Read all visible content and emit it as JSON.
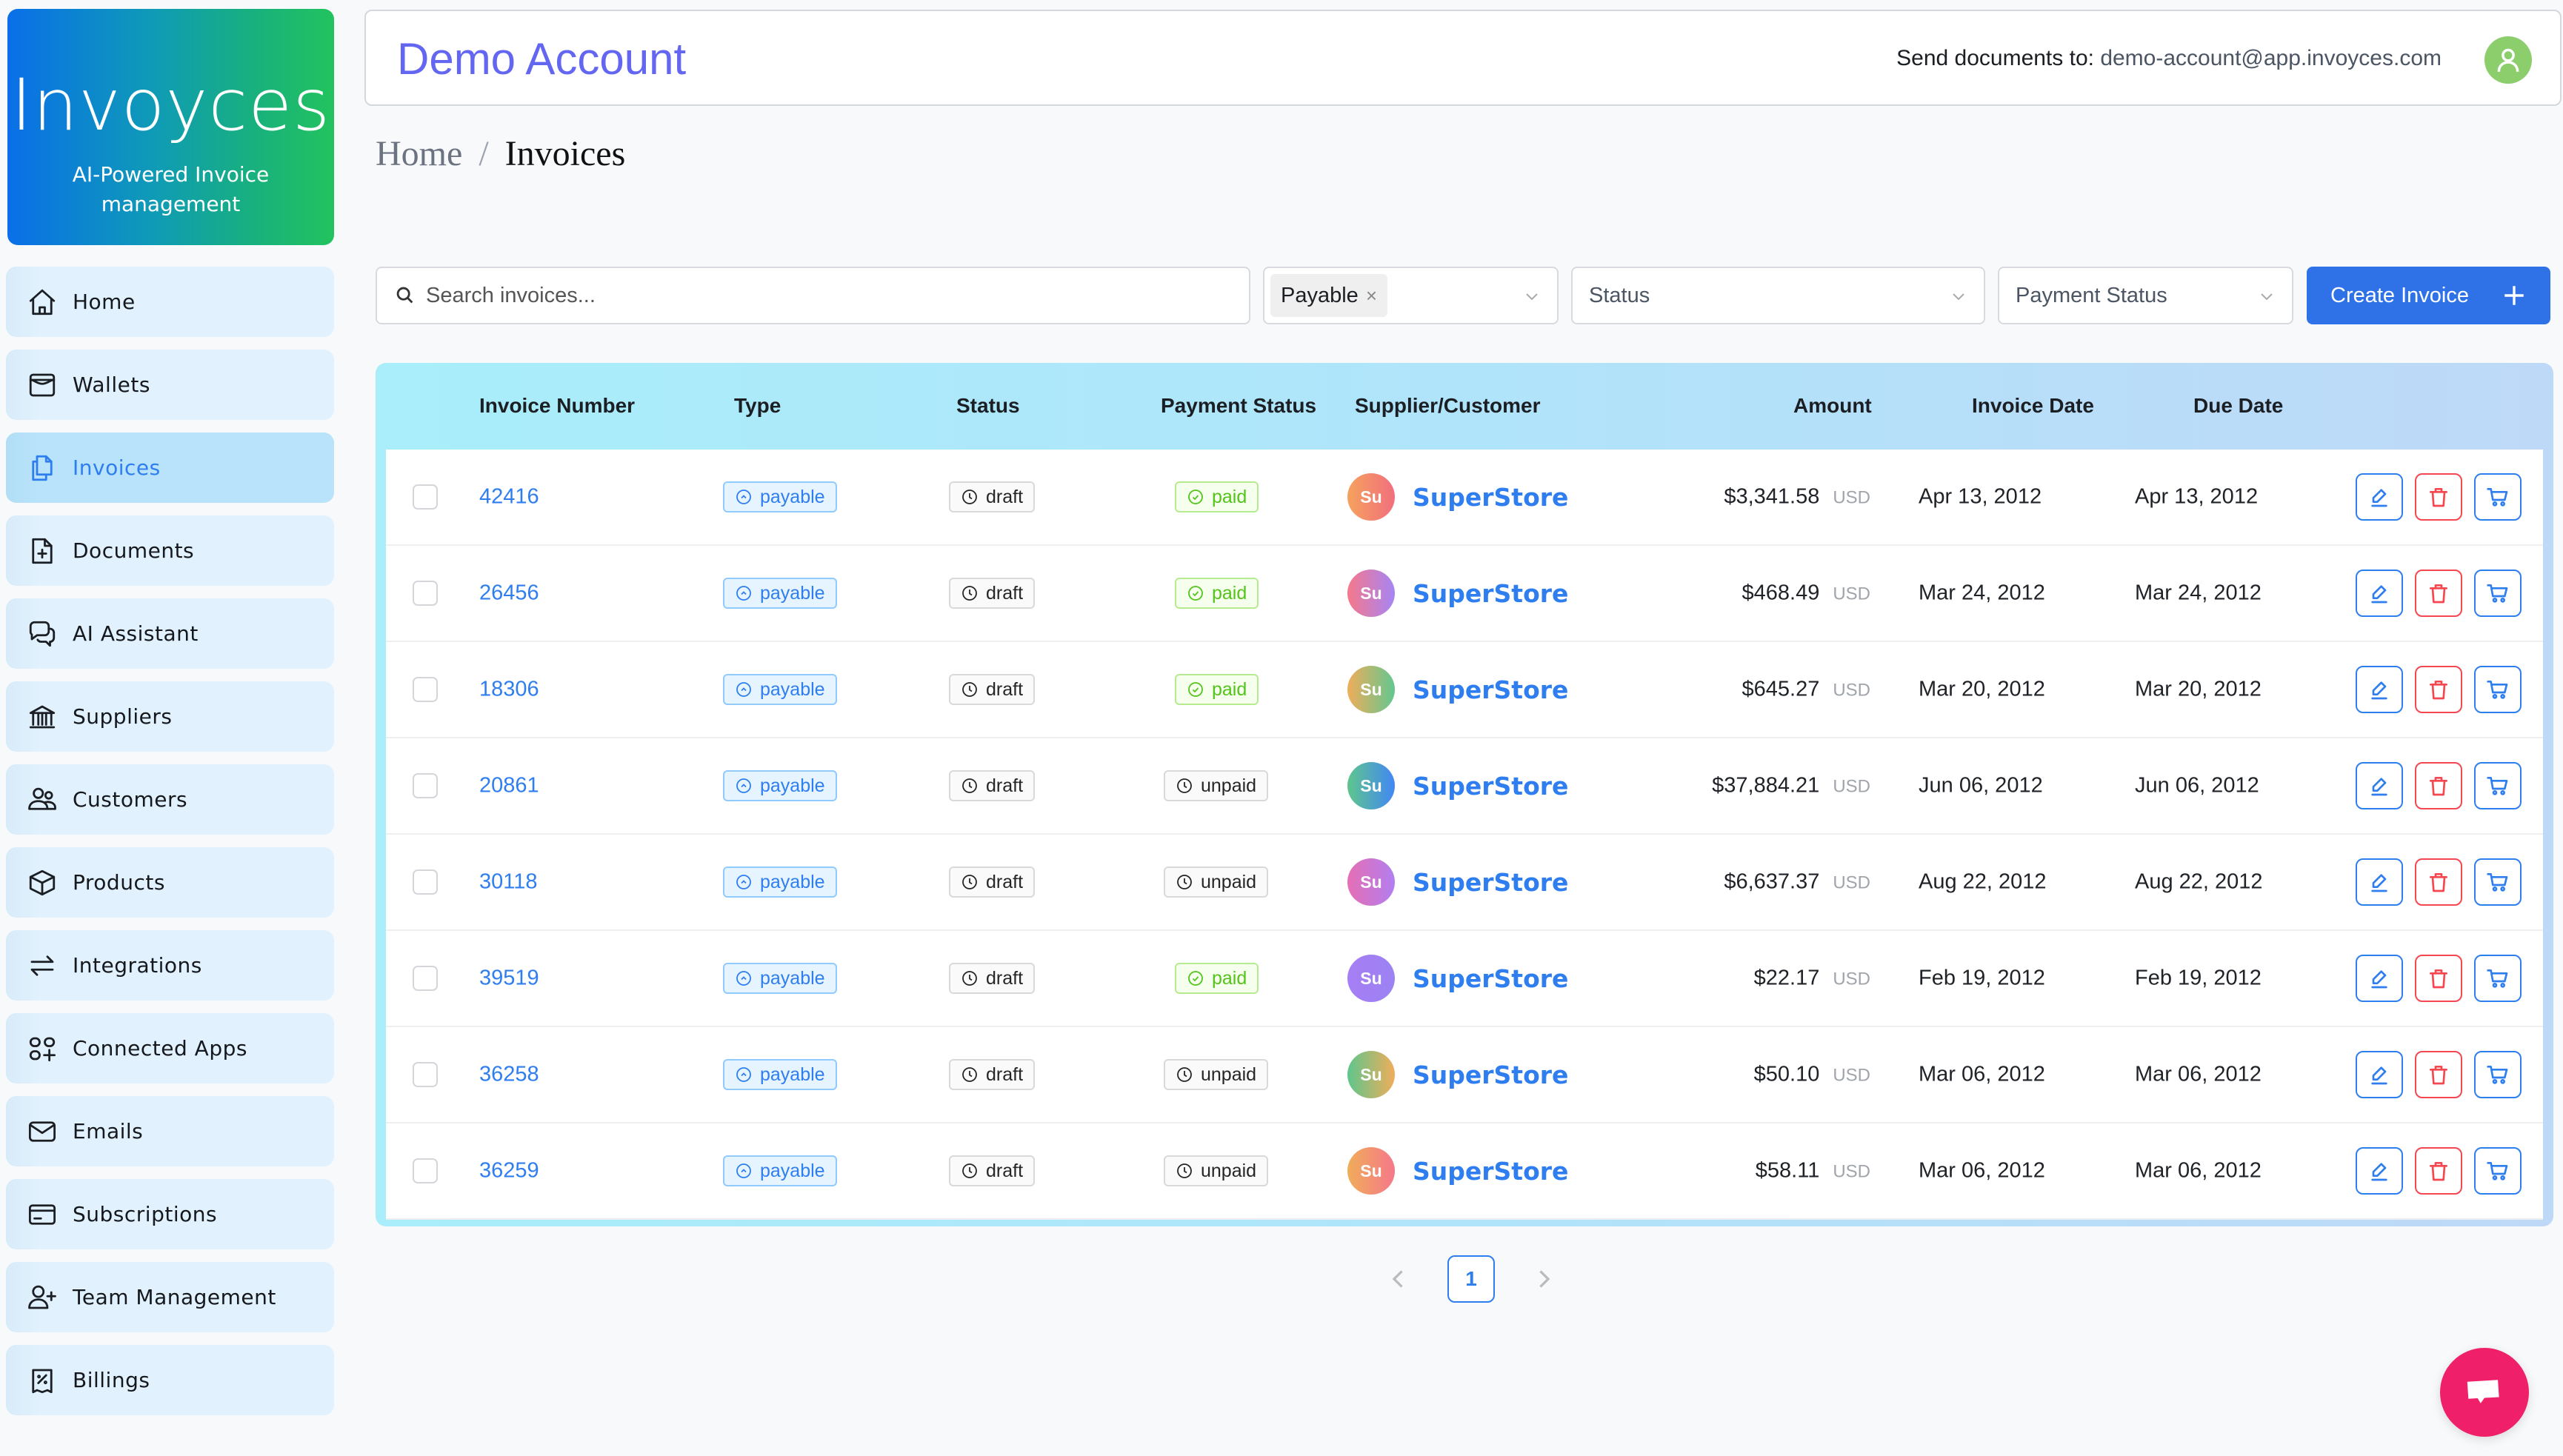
{
  "logo": {
    "title": "Invoyces",
    "subtitle": "AI-Powered Invoice management"
  },
  "sidebar": {
    "items": [
      {
        "label": "Home",
        "icon": "home-icon",
        "active": false
      },
      {
        "label": "Wallets",
        "icon": "wallet-icon",
        "active": false
      },
      {
        "label": "Invoices",
        "icon": "copy-documents-icon",
        "active": true
      },
      {
        "label": "Documents",
        "icon": "file-plus-icon",
        "active": false
      },
      {
        "label": "AI Assistant",
        "icon": "chat-bubbles-icon",
        "active": false
      },
      {
        "label": "Suppliers",
        "icon": "bank-icon",
        "active": false
      },
      {
        "label": "Customers",
        "icon": "users-icon",
        "active": false
      },
      {
        "label": "Products",
        "icon": "box-icon",
        "active": false
      },
      {
        "label": "Integrations",
        "icon": "arrows-exchange-icon",
        "active": false
      },
      {
        "label": "Connected Apps",
        "icon": "apps-add-icon",
        "active": false
      },
      {
        "label": "Emails",
        "icon": "mail-icon",
        "active": false
      },
      {
        "label": "Subscriptions",
        "icon": "credit-card-icon",
        "active": false
      },
      {
        "label": "Team Management",
        "icon": "user-add-icon",
        "active": false
      },
      {
        "label": "Billings",
        "icon": "receipt-percent-icon",
        "active": false
      }
    ]
  },
  "header": {
    "title": "Demo Account",
    "send_label": "Send documents to:",
    "send_email": "demo-account@app.invoyces.com",
    "avatar_color": "#8cce6c"
  },
  "breadcrumb": {
    "home": "Home",
    "separator": "/",
    "current": "Invoices"
  },
  "filters": {
    "search_placeholder": "Search invoices...",
    "search_value": "",
    "type_tag": "Payable",
    "type_tag_remove": "×",
    "status_placeholder": "Status",
    "payment_status_placeholder": "Payment Status",
    "create_button": "Create Invoice"
  },
  "table": {
    "columns": [
      "Invoice Number",
      "Type",
      "Status",
      "Payment Status",
      "Supplier/Customer",
      "Amount",
      "Invoice Date",
      "Due Date"
    ],
    "rows": [
      {
        "number": "42416",
        "type": "payable",
        "status": "draft",
        "payment": "paid",
        "avatar": "Su",
        "supplier": "SuperStore",
        "amount": "$3,341.58",
        "currency": "USD",
        "invoice_date": "Apr 13, 2012",
        "due_date": "Apr 13, 2012",
        "avatar_gradient": [
          "#f5a25d",
          "#f26f7e"
        ]
      },
      {
        "number": "26456",
        "type": "payable",
        "status": "draft",
        "payment": "paid",
        "avatar": "Su",
        "supplier": "SuperStore",
        "amount": "$468.49",
        "currency": "USD",
        "invoice_date": "Mar 24, 2012",
        "due_date": "Mar 24, 2012",
        "avatar_gradient": [
          "#f5788a",
          "#a685f5"
        ]
      },
      {
        "number": "18306",
        "type": "payable",
        "status": "draft",
        "payment": "paid",
        "avatar": "Su",
        "supplier": "SuperStore",
        "amount": "$645.27",
        "currency": "USD",
        "invoice_date": "Mar 20, 2012",
        "due_date": "Mar 20, 2012",
        "avatar_gradient": [
          "#f0ad5a",
          "#62c790"
        ]
      },
      {
        "number": "20861",
        "type": "payable",
        "status": "draft",
        "payment": "unpaid",
        "avatar": "Su",
        "supplier": "SuperStore",
        "amount": "$37,884.21",
        "currency": "USD",
        "invoice_date": "Jun 06, 2012",
        "due_date": "Jun 06, 2012",
        "avatar_gradient": [
          "#5ec68c",
          "#4287f5"
        ]
      },
      {
        "number": "30118",
        "type": "payable",
        "status": "draft",
        "payment": "unpaid",
        "avatar": "Su",
        "supplier": "SuperStore",
        "amount": "$6,637.37",
        "currency": "USD",
        "invoice_date": "Aug 22, 2012",
        "due_date": "Aug 22, 2012",
        "avatar_gradient": [
          "#e66fb4",
          "#b27ef0"
        ]
      },
      {
        "number": "39519",
        "type": "payable",
        "status": "draft",
        "payment": "paid",
        "avatar": "Su",
        "supplier": "SuperStore",
        "amount": "$22.17",
        "currency": "USD",
        "invoice_date": "Feb 19, 2012",
        "due_date": "Feb 19, 2012",
        "avatar_gradient": [
          "#a77ef5",
          "#9b82f2"
        ]
      },
      {
        "number": "36258",
        "type": "payable",
        "status": "draft",
        "payment": "unpaid",
        "avatar": "Su",
        "supplier": "SuperStore",
        "amount": "$50.10",
        "currency": "USD",
        "invoice_date": "Mar 06, 2012",
        "due_date": "Mar 06, 2012",
        "avatar_gradient": [
          "#5ec68c",
          "#f0ad5a"
        ]
      },
      {
        "number": "36259",
        "type": "payable",
        "status": "draft",
        "payment": "unpaid",
        "avatar": "Su",
        "supplier": "SuperStore",
        "amount": "$58.11",
        "currency": "USD",
        "invoice_date": "Mar 06, 2012",
        "due_date": "Mar 06, 2012",
        "avatar_gradient": [
          "#f0ad5a",
          "#f5788a"
        ]
      }
    ]
  },
  "pagination": {
    "current_page": "1"
  },
  "colors": {
    "accent": "#2f7ef0",
    "title": "#6366f1",
    "danger": "#f5474f",
    "paid": "#52c41a",
    "chat_button": "#f01f69"
  }
}
